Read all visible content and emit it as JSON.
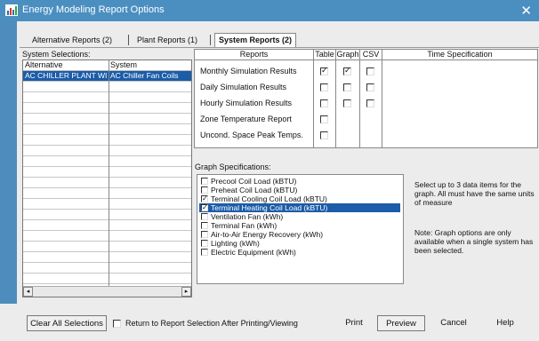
{
  "window": {
    "title": "Energy Modeling Report Options",
    "close_glyph": "✕"
  },
  "tabs": [
    {
      "label": "Alternative Reports (2)"
    },
    {
      "label": "Plant Reports (1)"
    },
    {
      "label": "System Reports (2)",
      "active": true
    }
  ],
  "system_selections": {
    "label": "System Selections:",
    "columns": [
      "Alternative",
      "System"
    ],
    "rows": [
      {
        "alternative": "AC CHILLER PLANT WI",
        "system": "AC Chiller Fan Coils",
        "selected": true
      }
    ],
    "scroll_left": "◂",
    "scroll_right": "▸"
  },
  "reports_grid": {
    "columns": [
      "Reports",
      "Table",
      "Graph",
      "CSV",
      "Time Specification"
    ],
    "rows": [
      {
        "label": "Monthly Simulation Results",
        "table": true,
        "graph": true,
        "csv": false
      },
      {
        "label": "Daily Simulation Results",
        "table": false,
        "graph": false,
        "csv": false
      },
      {
        "label": "Hourly Simulation Results",
        "table": false,
        "graph": false,
        "csv": false
      },
      {
        "label": "Zone Temperature Report",
        "table": false
      },
      {
        "label": "Uncond. Space Peak Temps.",
        "table": false
      }
    ]
  },
  "graph_specifications": {
    "label": "Graph Specifications:",
    "items": [
      {
        "label": "Precool Coil Load (kBTU)",
        "checked": false,
        "selected": false
      },
      {
        "label": "Preheat Coil Load (kBTU)",
        "checked": false,
        "selected": false
      },
      {
        "label": "Terminal Cooling Coil Load (kBTU)",
        "checked": true,
        "selected": false
      },
      {
        "label": "Terminal Heating Coil Load (kBTU)",
        "checked": true,
        "selected": true
      },
      {
        "label": "Ventilation Fan (kWh)",
        "checked": false,
        "selected": false
      },
      {
        "label": "Terminal Fan (kWh)",
        "checked": false,
        "selected": false
      },
      {
        "label": "Air-to-Air Energy Recovery (kWh)",
        "checked": false,
        "selected": false
      },
      {
        "label": "Lighting (kWh)",
        "checked": false,
        "selected": false
      },
      {
        "label": "Electric Equipment (kWh)",
        "checked": false,
        "selected": false
      }
    ],
    "help_text": "Select up to 3 data items for the graph. All must have the same units of measure",
    "note_text": "Note: Graph options are only available when a single system has been selected."
  },
  "footer": {
    "clear_all": "Clear All Selections",
    "return_checkbox": "Return to Report Selection After Printing/Viewing",
    "return_checked": false,
    "print": "Print",
    "preview": "Preview",
    "cancel": "Cancel",
    "help": "Help"
  },
  "check_glyph": "✓",
  "colors": {
    "titlebar": "#4b8fc1",
    "selection": "#1c5ca8",
    "background": "#ececec"
  }
}
